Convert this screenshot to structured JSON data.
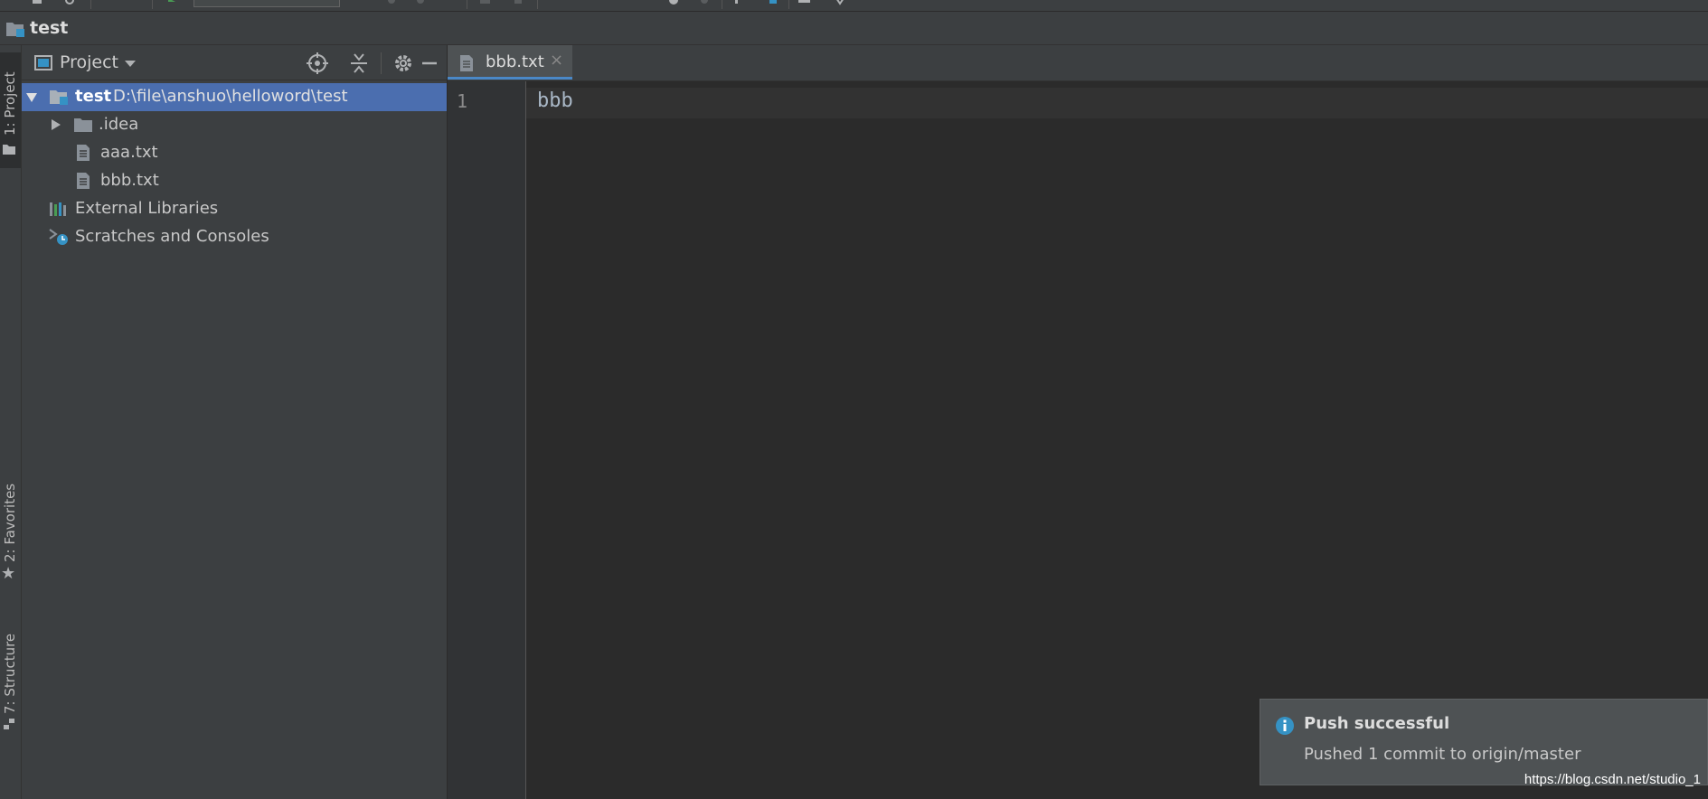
{
  "nav": {
    "title": "test"
  },
  "left_strip": {
    "tabs": [
      {
        "label": "1: Project"
      },
      {
        "label": "2: Favorites"
      },
      {
        "label": "7: Structure"
      }
    ]
  },
  "project_panel": {
    "title": "Project",
    "tree": [
      {
        "name": "test",
        "path": "D:\\file\\anshuo\\helloword\\test",
        "kind": "module-folder",
        "expanded": true,
        "selected": true
      },
      {
        "name": ".idea",
        "kind": "folder",
        "expanded": false
      },
      {
        "name": "aaa.txt",
        "kind": "text-file"
      },
      {
        "name": "bbb.txt",
        "kind": "text-file"
      },
      {
        "name": "External Libraries",
        "kind": "libraries"
      },
      {
        "name": "Scratches and Consoles",
        "kind": "scratches"
      }
    ]
  },
  "editor": {
    "tab": {
      "label": "bbb.txt",
      "close": "×"
    },
    "lines": [
      {
        "number": "1",
        "text": "bbb"
      }
    ]
  },
  "notification": {
    "title": "Push successful",
    "body": "Pushed 1 commit to origin/master"
  },
  "watermark": "https://blog.csdn.net/studio_1",
  "colors": {
    "panel_bg": "#3c3f41",
    "editor_bg": "#2b2b2b",
    "selection": "#4b6eaf",
    "tab_underline": "#4a88c7",
    "info_icon": "#3592c4"
  }
}
